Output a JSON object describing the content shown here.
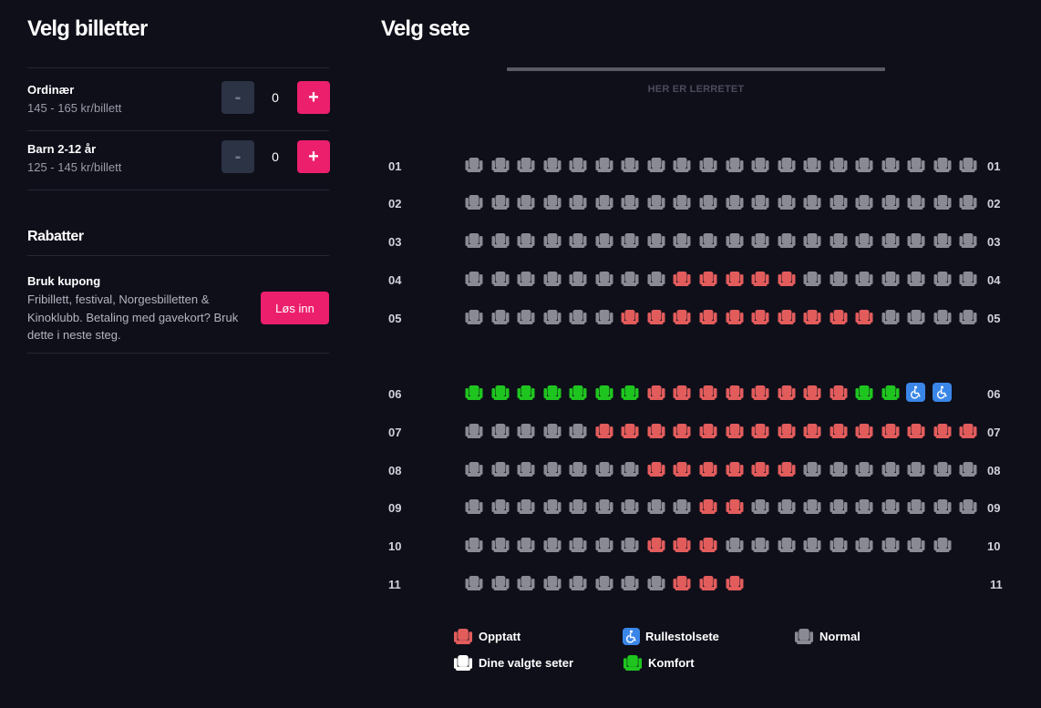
{
  "left_panel": {
    "title": "Velg billetter",
    "tickets": [
      {
        "name": "Ordinær",
        "price": "145 - 165 kr/billett",
        "quantity": "0",
        "minus": "-",
        "plus": "+"
      },
      {
        "name": "Barn 2-12 år",
        "price": "125 - 145 kr/billett",
        "quantity": "0",
        "minus": "-",
        "plus": "+"
      }
    ],
    "discounts": {
      "title": "Rabatter",
      "coupon_title": "Bruk kupong",
      "coupon_desc": "Fribillett, festival, Norgesbilletten & Kinoklubb. Betaling med gavekort? Bruk dette i neste steg.",
      "redeem_label": "Løs inn"
    }
  },
  "seat_panel": {
    "title": "Velg sete",
    "screen_label": "HER ER LERRETET",
    "rows": [
      {
        "label": "01",
        "seats": "NNNNNNNNNNNNNNNNNNNN"
      },
      {
        "label": "02",
        "seats": "NNNNNNNNNNNNNNNNNNNN"
      },
      {
        "label": "03",
        "seats": "NNNNNNNNNNNNNNNNNNNN"
      },
      {
        "label": "04",
        "seats": "NNNNNNNNOOOOONNNNNNN"
      },
      {
        "label": "05",
        "seats": "NNNNNNOOOOOOOOOONNNN"
      },
      {
        "label": "06",
        "seats": "CCCCCCCOOOOOOOOCCWW"
      },
      {
        "label": "07",
        "seats": "NNNNNOOOOOOOOOOOOOOO"
      },
      {
        "label": "08",
        "seats": "NNNNNNNOOOOOONNNNNNN"
      },
      {
        "label": "09",
        "seats": "NNNNNNNNNOONNNNNNNNN"
      },
      {
        "label": "10",
        "seats": "NNNNNNNOOONNNNNNNNN"
      },
      {
        "label": "11",
        "seats": "NNNNNNNNOOO"
      }
    ],
    "legend": {
      "occupied": "Opptatt",
      "wheelchair": "Rullestolsete",
      "normal": "Normal",
      "selected": "Dine valgte seter",
      "comfort": "Komfort"
    }
  },
  "colors": {
    "background": "#0f0f1a",
    "accent": "#ec1f6c",
    "seat_normal": "#8a8a94",
    "seat_occupied": "#e25c5c",
    "seat_comfort": "#1fc51f",
    "seat_wheelchair": "#3a86e8",
    "seat_selected": "#ffffff"
  },
  "icons": {
    "seat": "armchair-icon",
    "wheelchair": "wheelchair-icon"
  }
}
